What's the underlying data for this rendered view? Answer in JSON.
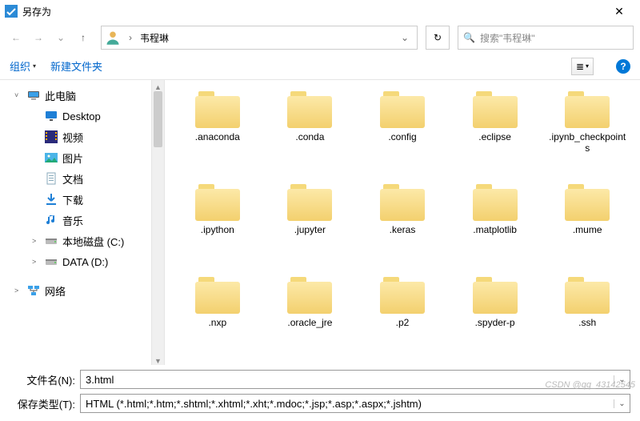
{
  "window": {
    "title": "另存为",
    "close_glyph": "✕"
  },
  "nav": {
    "back_glyph": "←",
    "forward_glyph": "→",
    "history_glyph": "⌄",
    "up_glyph": "↑",
    "refresh_glyph": "↻"
  },
  "address": {
    "crumb_sep": "›",
    "crumb1": "韦程琳",
    "dropdown_glyph": "⌄"
  },
  "search": {
    "icon_glyph": "🔍",
    "placeholder": "搜索\"韦程琳\""
  },
  "toolbar": {
    "organize": "组织",
    "new_folder": "新建文件夹",
    "drop_glyph": "▾",
    "view_glyph": "≣",
    "help_glyph": "?"
  },
  "tree": {
    "expand_glyph": "˅",
    "collapse_glyph": "˃",
    "items": [
      {
        "label": "此电脑",
        "icon": "pc",
        "indent": false,
        "exp": "˅"
      },
      {
        "label": "Desktop",
        "icon": "desk",
        "indent": true,
        "exp": ""
      },
      {
        "label": "视频",
        "icon": "vid",
        "indent": true,
        "exp": ""
      },
      {
        "label": "图片",
        "icon": "pic",
        "indent": true,
        "exp": ""
      },
      {
        "label": "文档",
        "icon": "doc",
        "indent": true,
        "exp": ""
      },
      {
        "label": "下载",
        "icon": "down",
        "indent": true,
        "exp": ""
      },
      {
        "label": "音乐",
        "icon": "mus",
        "indent": true,
        "exp": ""
      },
      {
        "label": "本地磁盘 (C:)",
        "icon": "disk",
        "indent": true,
        "exp": "˃"
      },
      {
        "label": "DATA (D:)",
        "icon": "disk",
        "indent": true,
        "exp": "˃"
      },
      {
        "label": "网络",
        "icon": "net",
        "indent": false,
        "exp": "˃"
      }
    ]
  },
  "files": [
    {
      "name": ".anaconda"
    },
    {
      "name": ".conda"
    },
    {
      "name": ".config"
    },
    {
      "name": ".eclipse"
    },
    {
      "name": ".ipynb_checkpoints"
    },
    {
      "name": ".ipython"
    },
    {
      "name": ".jupyter"
    },
    {
      "name": ".keras"
    },
    {
      "name": ".matplotlib"
    },
    {
      "name": ".mume"
    },
    {
      "name": ".nxp"
    },
    {
      "name": ".oracle_jre"
    },
    {
      "name": ".p2"
    },
    {
      "name": ".spyder-p"
    },
    {
      "name": ".ssh"
    }
  ],
  "bottom": {
    "filename_label": "文件名(N):",
    "filename_value": "3.html",
    "filetype_label": "保存类型(T):",
    "filetype_value": "HTML (*.html;*.htm;*.shtml;*.xhtml;*.xht;*.mdoc;*.jsp;*.asp;*.aspx;*.jshtm)"
  },
  "watermark": "CSDN @qq_43142545"
}
